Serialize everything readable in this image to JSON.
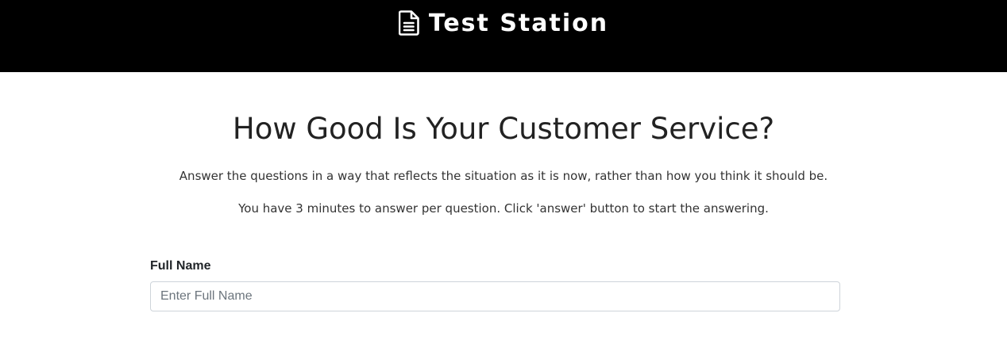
{
  "header": {
    "brand_name": "Test Station",
    "brand_icon": "document-icon",
    "background_color": "#000000",
    "text_color": "#ffffff"
  },
  "intro": {
    "title": "How Good Is Your Customer Service?",
    "description_1": "Answer the questions in a way that reflects the situation as it is now, rather than how you think it should be.",
    "description_2": "You have 3 minutes to answer per question. Click 'answer' button to start the answering."
  },
  "form": {
    "full_name": {
      "label": "Full Name",
      "placeholder": "Enter Full Name",
      "value": ""
    }
  }
}
